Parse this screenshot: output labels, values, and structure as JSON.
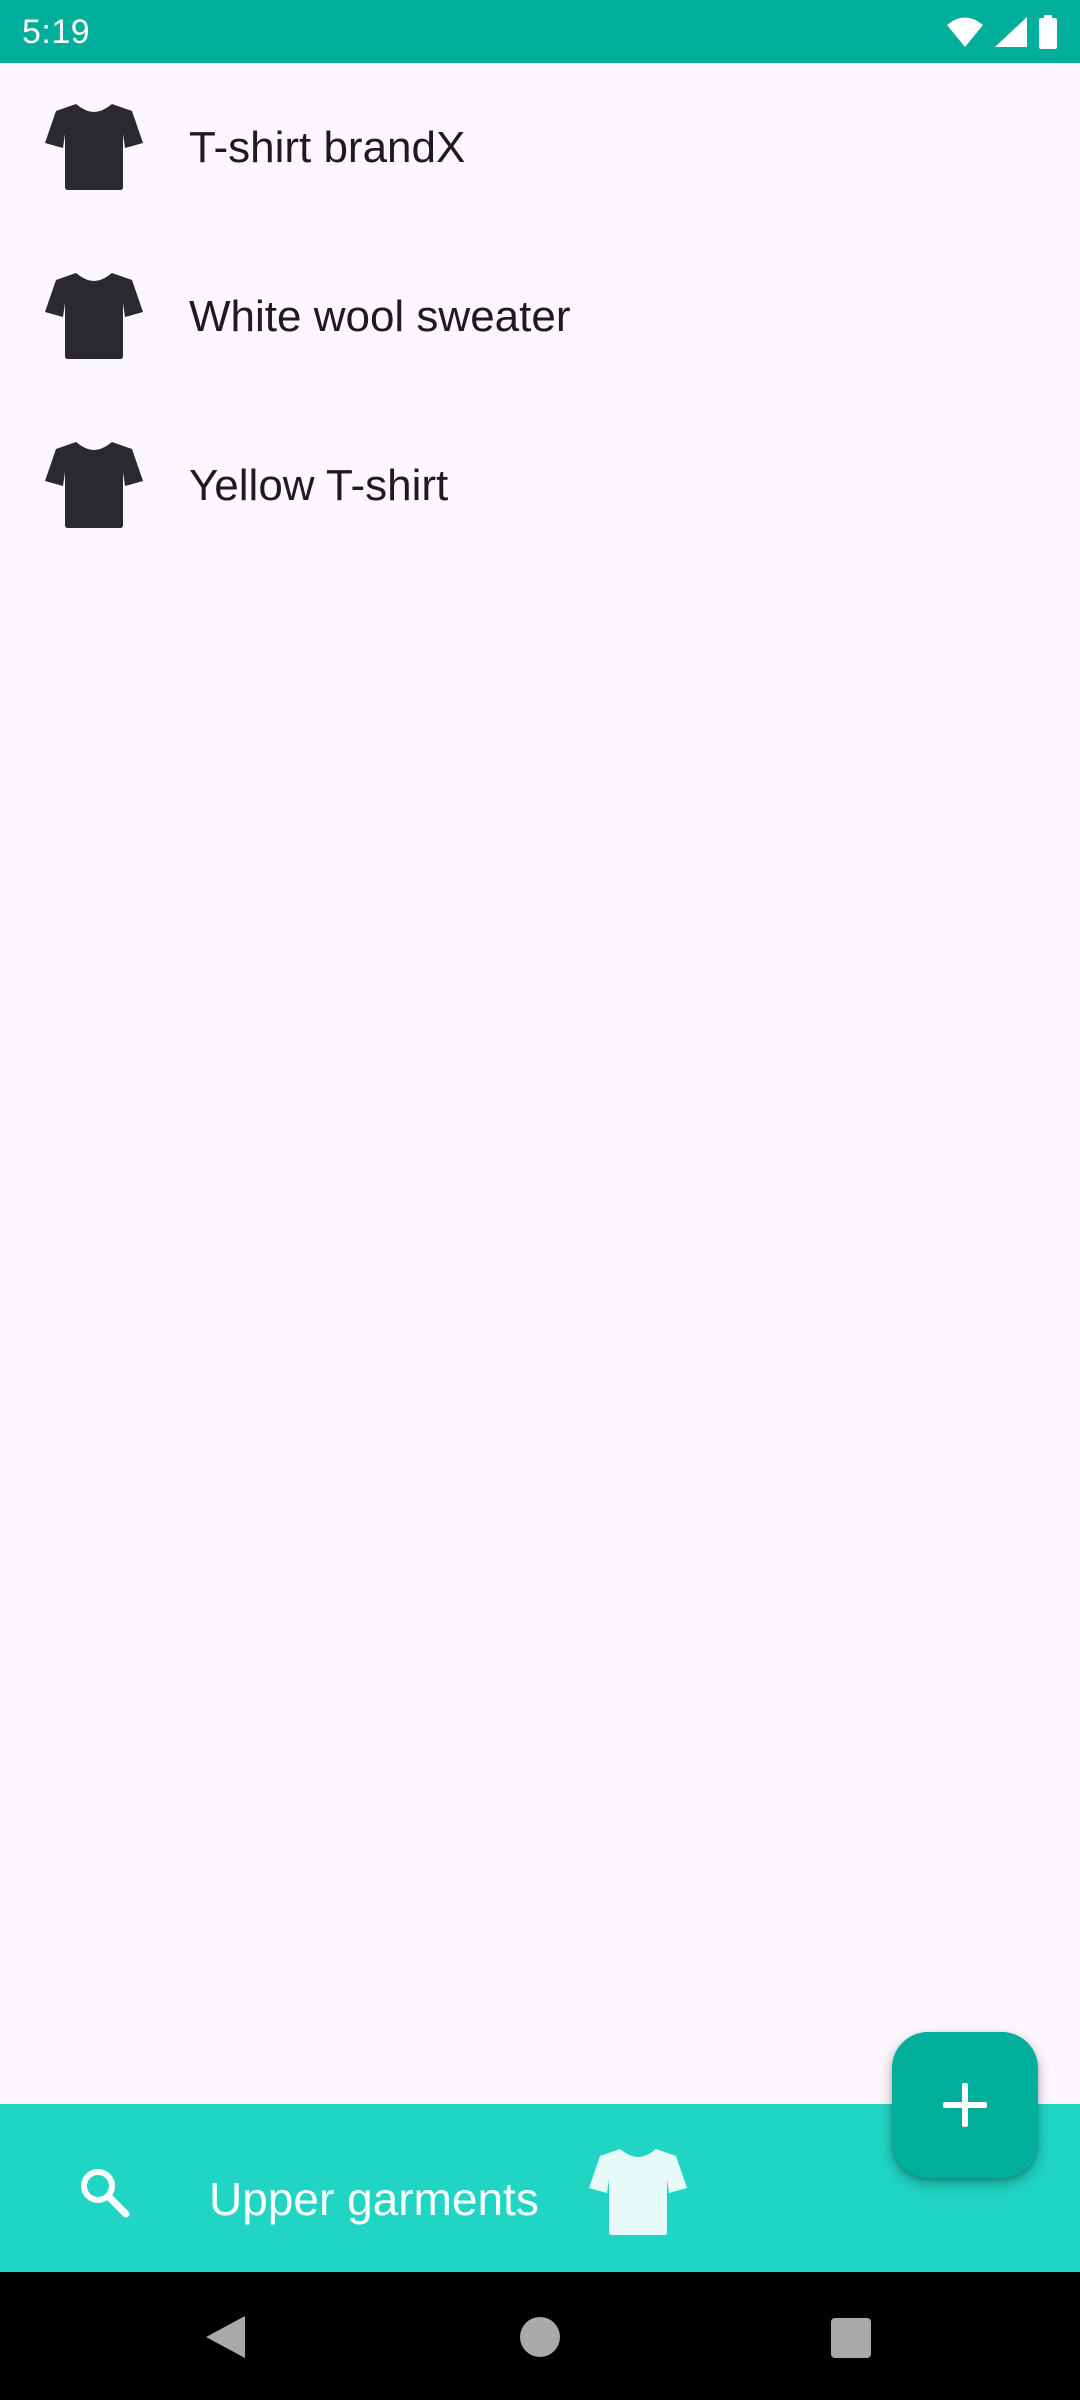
{
  "status_bar": {
    "time": "5:19",
    "icons": [
      "wifi-icon",
      "cell-signal-icon",
      "battery-icon"
    ],
    "background": "#00AE9A"
  },
  "list": {
    "items": [
      {
        "label": "T-shirt brandX",
        "icon": "tshirt-icon"
      },
      {
        "label": "White wool sweater",
        "icon": "tshirt-icon"
      },
      {
        "label": "Yellow T-shirt",
        "icon": "tshirt-icon"
      }
    ]
  },
  "bottom_bar": {
    "category_label": "Upper garments",
    "search_icon": "search-icon",
    "category_icon": "tshirt-icon",
    "background": "#20D5C4"
  },
  "fab": {
    "icon": "plus-icon",
    "background": "#00AE9A"
  },
  "nav_bar": {
    "icons": [
      "back-icon",
      "home-icon",
      "recents-icon"
    ]
  },
  "colors": {
    "page_background": "#FCF7FD",
    "icon_dark": "#2B2930",
    "accent": "#00AE9A",
    "accent_light": "#20D5C4"
  }
}
